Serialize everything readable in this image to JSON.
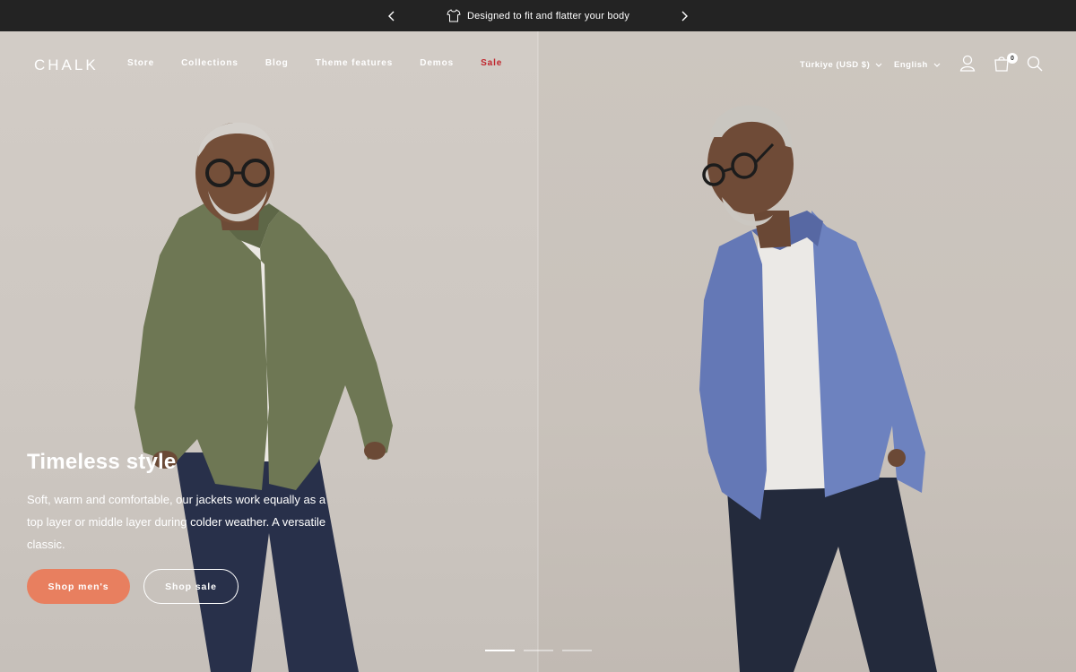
{
  "announcement": {
    "message": "Designed to fit and flatter your body",
    "icon": "tshirt-icon"
  },
  "header": {
    "logo": "CHALK",
    "nav": [
      "Store",
      "Collections",
      "Blog",
      "Theme features",
      "Demos",
      "Sale"
    ],
    "currency": "Türkiye (USD $)",
    "language": "English",
    "cart_count": "0"
  },
  "hero": {
    "title": "Timeless style",
    "text": "Soft, warm and comfortable, our jackets work equally as a top layer or middle layer during colder weather. A versatile classic.",
    "primary_button": "Shop men's",
    "secondary_button": "Shop sale",
    "slides": 3,
    "active_slide": 1
  },
  "colors": {
    "announcement_bg": "#232323",
    "sale": "#c0262d",
    "primary_button": "#e87f5f"
  }
}
